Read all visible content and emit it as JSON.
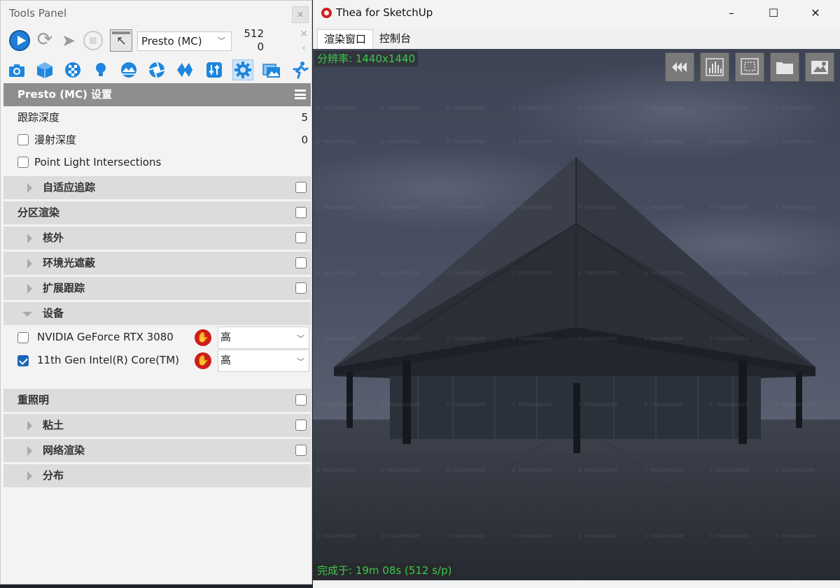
{
  "tools_panel": {
    "title": "Tools Panel",
    "close_glyph": "✕",
    "engine": "Presto (MC)",
    "count_top": "512",
    "count_bottom": "0",
    "section_title": "Presto (MC) 设置",
    "trace_depth": {
      "label": "跟踪深度",
      "value": "5"
    },
    "diffuse_depth": {
      "label": "漫射深度",
      "value": "0",
      "checked": false
    },
    "point_light": {
      "label": "Point Light Intersections",
      "checked": false
    },
    "groups": {
      "adaptive": "自适应追踪",
      "region": "分区渲染",
      "out_of_core": "核外",
      "ao": "环境光遮蔽",
      "extended": "扩展跟踪",
      "devices": "设备",
      "relight": "重照明",
      "clay": "粘土",
      "network": "网络渲染",
      "distribution": "分布"
    },
    "devices": [
      {
        "name": "NVIDIA GeForce RTX 3080",
        "priority": "高",
        "checked": false
      },
      {
        "name": "11th Gen Intel(R) Core(TM)",
        "priority": "高",
        "checked": true
      }
    ]
  },
  "thea_window": {
    "title": "Thea for SketchUp",
    "tabs": [
      "渲染窗口",
      "控制台"
    ],
    "resolution_label": "分辨率:  1440x1440",
    "done_label": "完成于:  19m 08s (512 s/p)"
  },
  "colors": {
    "accent_blue": "#1e7ed8",
    "status_green": "#3cc84c",
    "stop_red": "#d01c1c"
  }
}
